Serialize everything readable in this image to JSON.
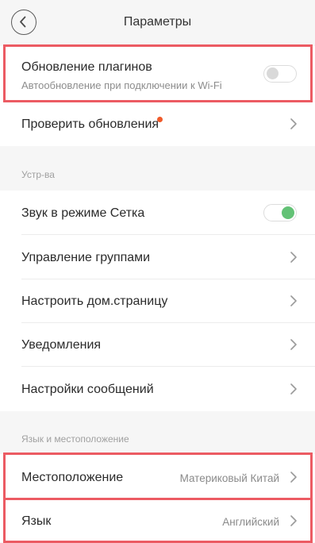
{
  "header": {
    "title": "Параметры"
  },
  "colors": {
    "highlight": "#ec5b63",
    "notification_dot": "#f05a2a",
    "toggle_on": "#63c276",
    "background": "#f6f6f6"
  },
  "plugins": {
    "label": "Обновление плагинов",
    "subtitle": "Автообновление при подключении к Wi-Fi",
    "toggle_on": false
  },
  "check_updates": {
    "label": "Проверить обновления",
    "has_notification": true
  },
  "devices_section": {
    "header": "Устр-ва",
    "items": [
      {
        "label": "Звук в режиме Сетка",
        "control": "toggle",
        "toggle_on": true
      },
      {
        "label": "Управление группами",
        "control": "chevron"
      },
      {
        "label": "Настроить дом.страницу",
        "control": "chevron"
      },
      {
        "label": "Уведомления",
        "control": "chevron"
      },
      {
        "label": "Настройки сообщений",
        "control": "chevron"
      }
    ]
  },
  "language_section": {
    "header": "Язык и местоположение",
    "location": {
      "label": "Местоположение",
      "value": "Материковый Китай"
    },
    "language": {
      "label": "Язык",
      "value": "Английский"
    }
  },
  "icons": {
    "back": "back-arrow-icon",
    "chevron": "chevron-right-icon"
  }
}
